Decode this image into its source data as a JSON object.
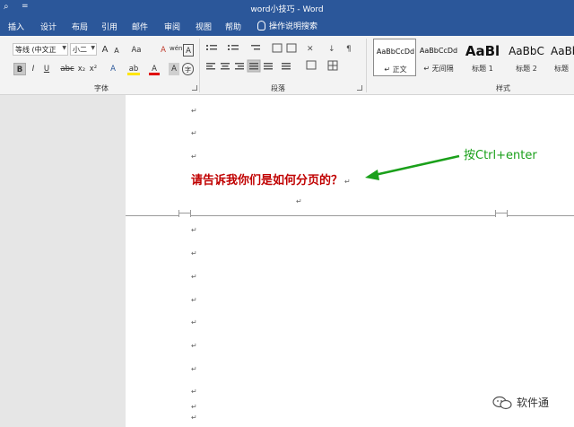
{
  "titlebar": {
    "title": "word小技巧  -  Word",
    "quick_icon1": "⌕",
    "quick_icon2": "="
  },
  "tabs": {
    "items": [
      "插入",
      "设计",
      "布局",
      "引用",
      "邮件",
      "审阅",
      "视图",
      "帮助"
    ],
    "tell_me": "操作说明搜索"
  },
  "font_group": {
    "font_name": "等线 (中文正",
    "font_size": "小二",
    "grow": "A",
    "shrink": "A",
    "case": "Aa",
    "clear_format": "A",
    "phonetic": "wén",
    "border_char": "A",
    "bold": "B",
    "italic": "I",
    "underline": "U",
    "strike": "abc",
    "subscript": "x₂",
    "superscript": "x²",
    "text_effects": "A",
    "highlight": "ab",
    "font_color": "A",
    "char_shading": "A",
    "enclose": "字",
    "label": "字体"
  },
  "paragraph_group": {
    "label": "段落"
  },
  "styles_group": {
    "label": "样式",
    "items": [
      {
        "sample": "AaBbCcDd",
        "name": "↵ 正文"
      },
      {
        "sample": "AaBbCcDd",
        "name": "↵ 无间隔"
      },
      {
        "sample": "AaBl",
        "name": "标题 1"
      },
      {
        "sample": "AaBbC",
        "name": "标题 2"
      },
      {
        "sample": "AaBb",
        "name": "标题"
      }
    ]
  },
  "document": {
    "paragraph_mark": "↵",
    "question": "请告诉我你们是如何分页的？",
    "annotation": "按Ctrl+enter"
  },
  "watermark": {
    "text": "软件通"
  },
  "colors": {
    "brand_blue": "#2b579a",
    "question_red": "#c00000",
    "annotation_green": "#1aa01a"
  }
}
